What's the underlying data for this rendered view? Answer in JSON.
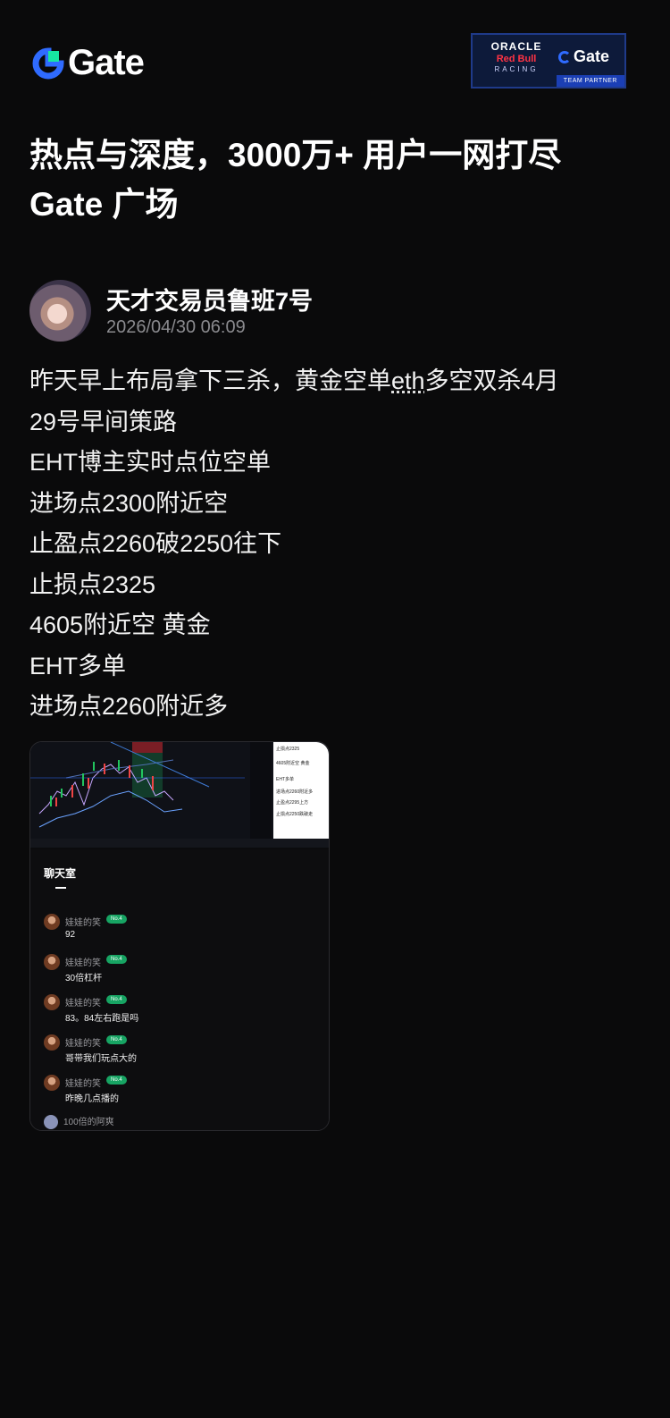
{
  "brand": {
    "logo_text": "Gate",
    "partner": {
      "line1": "ORACLE",
      "line2": "Red Bull",
      "line3": "RACING",
      "gate": "Gate",
      "tag": "TEAM PARTNER"
    }
  },
  "headline": {
    "line1": "热点与深度，3000万+ 用户一网打尽",
    "line2": "Gate 广场"
  },
  "author": {
    "name": "天才交易员鲁班7号",
    "time": "2026/04/30 06:09"
  },
  "post": {
    "line1_a": "昨天早上布局拿下三杀，黄金空单",
    "line1_link": "eth",
    "line1_b": "多空双杀4月",
    "lines": [
      "29号早间策路",
      "EHT博主实时点位空单",
      "进场点2300附近空",
      "止盈点2260破2250往下",
      "止损点2325",
      "4605附近空 黄金",
      "EHT多单",
      "进场点2260附近多"
    ]
  },
  "screenshot": {
    "notes": [
      "止损点2325",
      "4605附近空 黄金",
      "EHT多单",
      "进场点2260附近多",
      "止盈点2295上方",
      "止损点2250跌破走"
    ],
    "chat_title": "聊天室",
    "badge": "No.4",
    "messages": [
      {
        "name": "娃娃的笑",
        "text": "92"
      },
      {
        "name": "娃娃的笑",
        "text": "30倍杠杆"
      },
      {
        "name": "娃娃的笑",
        "text": "83。84左右跑是吗"
      },
      {
        "name": "娃娃的笑",
        "text": "哥带我们玩点大的"
      },
      {
        "name": "娃娃的笑",
        "text": "昨晚几点播的"
      }
    ],
    "last_name": "100倍的阿爽"
  },
  "colors": {
    "bg": "#0a0a0b",
    "brand_blue": "#2f6bff",
    "brand_green": "#17e6a1",
    "badge_green": "#17a463"
  }
}
